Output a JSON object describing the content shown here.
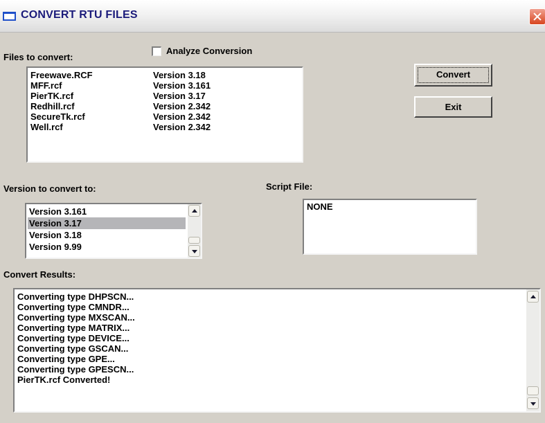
{
  "window": {
    "title": "CONVERT RTU FILES"
  },
  "files": {
    "label": "Files to convert:",
    "items": [
      {
        "name": "Freewave.RCF",
        "version": "Version 3.18"
      },
      {
        "name": "MFF.rcf",
        "version": "Version 3.161"
      },
      {
        "name": "PierTK.rcf",
        "version": "Version 3.17"
      },
      {
        "name": "Redhill.rcf",
        "version": "Version 2.342"
      },
      {
        "name": "SecureTk.rcf",
        "version": "Version 2.342"
      },
      {
        "name": "Well.rcf",
        "version": "Version 2.342"
      }
    ]
  },
  "analyze": {
    "label": "Analyze Conversion",
    "checked": false
  },
  "buttons": {
    "convert": "Convert",
    "exit": "Exit"
  },
  "target_version": {
    "label": "Version to convert to:",
    "options": [
      "Version 3.161",
      "Version 3.17",
      "Version 3.18",
      "Version 9.99"
    ],
    "selected": "Version 3.17"
  },
  "script": {
    "label": "Script File:",
    "value": "NONE"
  },
  "results": {
    "label": "Convert Results:",
    "lines": [
      "Converting type DHPSCN...",
      "Converting type CMNDR...",
      "Converting type MXSCAN...",
      "Converting type MATRIX...",
      "Converting type DEVICE...",
      "Converting type GSCAN...",
      "Converting type GPE...",
      "Converting type GPESCN...",
      "PierTK.rcf Converted!"
    ]
  },
  "icons": {
    "window": "window-icon",
    "close": "close-icon",
    "scroll_up": "chevron-up-icon",
    "scroll_down": "chevron-down-icon"
  },
  "colors": {
    "selection": "#b5b5b8",
    "close_button": "#d8461f",
    "title_text": "#1a1a7a",
    "dialog_bg": "#d4d0c8"
  }
}
